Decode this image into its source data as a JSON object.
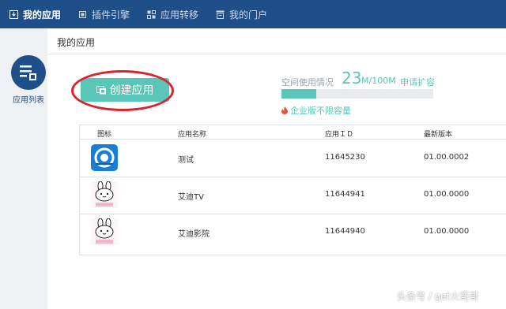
{
  "nav": {
    "items": [
      {
        "label": "我的应用",
        "icon": "download-box-icon",
        "active": true
      },
      {
        "label": "插件引擎",
        "icon": "frame-icon",
        "active": false
      },
      {
        "label": "应用转移",
        "icon": "transfer-icon",
        "active": false
      },
      {
        "label": "我的门户",
        "icon": "portal-icon",
        "active": false
      }
    ]
  },
  "sidebar": {
    "items": [
      {
        "label": "应用列表",
        "icon": "app-list-icon"
      }
    ]
  },
  "main": {
    "title": "我的应用",
    "create_button": "创建应用",
    "space": {
      "label": "空间使用情况",
      "used": "23",
      "unit": "M/100M",
      "expand_link": "申请扩容",
      "used_fraction": 0.23
    },
    "enterprise_note": "企业版不限容量",
    "table": {
      "headers": [
        "图标",
        "应用名称",
        "应用ＩＤ",
        "最新版本"
      ],
      "rows": [
        {
          "name": "测试",
          "id": "11645230",
          "version": "01.00.0002",
          "icon": "blue-app-icon"
        },
        {
          "name": "艾迪TV",
          "id": "11644941",
          "version": "01.00.0000",
          "icon": "rabbit-app-icon"
        },
        {
          "name": "艾迪影院",
          "id": "11644940",
          "version": "01.00.0000",
          "icon": "rabbit-app-icon"
        }
      ]
    }
  },
  "watermark": "头条号 / get火哥哥",
  "colors": {
    "nav_bg": "#1f4f88",
    "accent_teal": "#5ac6b8",
    "annotation_red": "#d9232e"
  }
}
